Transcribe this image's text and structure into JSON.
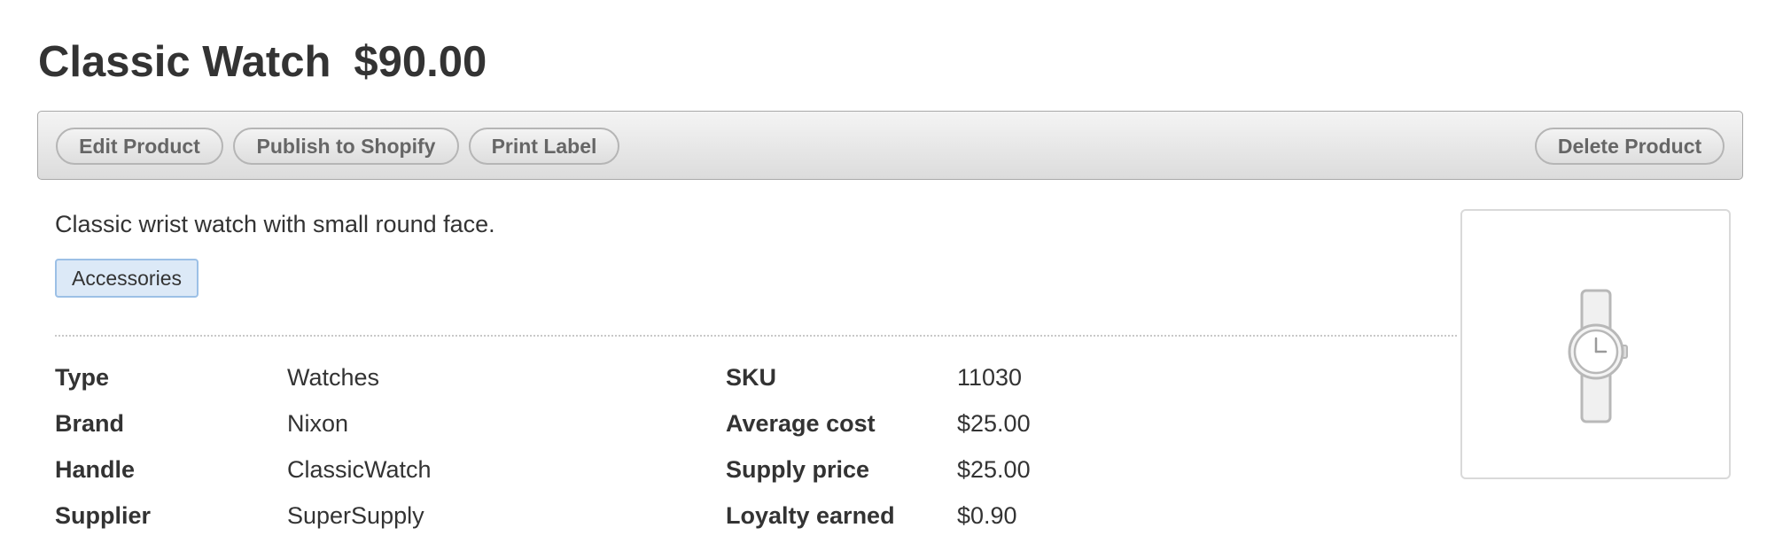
{
  "product": {
    "title": "Classic Watch",
    "price": "$90.00",
    "description": "Classic wrist watch with small round face.",
    "tag": "Accessories",
    "image_icon": "watch-icon"
  },
  "toolbar": {
    "edit_label": "Edit Product",
    "publish_label": "Publish to Shopify",
    "print_label": "Print Label",
    "delete_label": "Delete Product"
  },
  "details_left": [
    {
      "label": "Type",
      "value": "Watches"
    },
    {
      "label": "Brand",
      "value": "Nixon"
    },
    {
      "label": "Handle",
      "value": "ClassicWatch"
    },
    {
      "label": "Supplier",
      "value": "SuperSupply"
    }
  ],
  "details_right": [
    {
      "label": "SKU",
      "value": "11030"
    },
    {
      "label": "Average cost",
      "value": "$25.00"
    },
    {
      "label": "Supply price",
      "value": "$25.00"
    },
    {
      "label": "Loyalty earned",
      "value": "$0.90"
    }
  ],
  "colors": {
    "tag_background": "#dce9f7",
    "tag_border": "#9cc0e6",
    "toolbar_border": "#a8a8a8",
    "text": "#333333"
  }
}
